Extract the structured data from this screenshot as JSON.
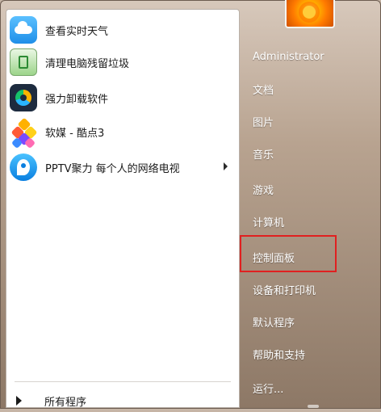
{
  "start_menu": {
    "programs": [
      {
        "label": "查看实时天气",
        "icon": "weather-icon"
      },
      {
        "label": "清理电脑残留垃圾",
        "icon": "clean-junk-icon"
      },
      {
        "label": "强力卸载软件",
        "icon": "uninstall-icon"
      },
      {
        "label": "软媒 - 酷点3",
        "icon": "ruanmei-icon"
      },
      {
        "label": "PPTV聚力 每个人的网络电视",
        "icon": "pptv-icon",
        "has_submenu": true
      }
    ],
    "all_programs_label": "所有程序",
    "right_items": [
      {
        "label": "Administrator"
      },
      {
        "label": "文档"
      },
      {
        "label": "图片"
      },
      {
        "label": "音乐"
      },
      {
        "label": "游戏"
      },
      {
        "label": "计算机"
      },
      {
        "label": "控制面板",
        "highlighted": true
      },
      {
        "label": "设备和打印机"
      },
      {
        "label": "默认程序"
      },
      {
        "label": "帮助和支持"
      },
      {
        "label": "运行..."
      }
    ]
  }
}
